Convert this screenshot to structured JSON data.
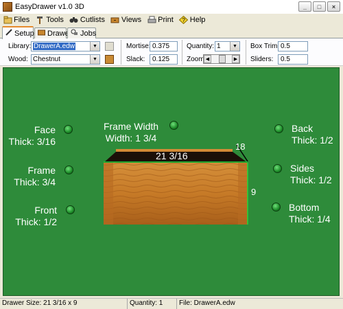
{
  "window": {
    "title": "EasyDrawer v1.0 3D",
    "buttons": [
      "_",
      "□",
      "×"
    ]
  },
  "menu": [
    {
      "label": "Files",
      "icon": "files-icon"
    },
    {
      "label": "Tools",
      "icon": "hammer-icon"
    },
    {
      "label": "Cutlists",
      "icon": "binoculars-icon"
    },
    {
      "label": "Views",
      "icon": "drawer-icon"
    },
    {
      "label": "Print",
      "icon": "printer-icon"
    },
    {
      "label": "Help",
      "icon": "help-diamond-icon"
    }
  ],
  "tabs": [
    {
      "label": "Setup",
      "active": true
    },
    {
      "label": "Drawer",
      "active": false
    },
    {
      "label": "Jobs",
      "active": false
    }
  ],
  "setup": {
    "library_label": "Library:",
    "library_value": "DrawerA.edw",
    "wood_label": "Wood:",
    "wood_value": "Chestnut",
    "mortise_label": "Mortise:",
    "mortise_value": "0.375",
    "slack_label": "Slack:",
    "slack_value": "0.125",
    "quantity_label": "Quantity:",
    "quantity_value": "1",
    "zoom_label": "Zoom:",
    "zoom_left": "◀",
    "zoom_right": "▶",
    "boxtrim_label": "Box Trim:",
    "boxtrim_value": "0.5",
    "sliders_label": "Sliders:",
    "sliders_value": "0.5",
    "dropdown_arrow": "▼"
  },
  "canvas": {
    "bg_color": "#2e8b3a",
    "face": {
      "line1": "Face",
      "line2": "Thick: 3/16"
    },
    "frame_width": {
      "line1": "Frame Width",
      "line2": "Width: 1 3/4"
    },
    "back": {
      "line1": "Back",
      "line2": "Thick: 1/2"
    },
    "frame": {
      "line1": "Frame",
      "line2": "Thick: 3/4"
    },
    "sides": {
      "line1": "Sides",
      "line2": "Thick: 1/2"
    },
    "front": {
      "line1": "Front",
      "line2": "Thick: 1/2"
    },
    "bottom": {
      "line1": "Bottom",
      "line2": "Thick: 1/4"
    },
    "dim_width": "21 3/16",
    "dim_depth": "18",
    "dim_height": "9"
  },
  "status": {
    "size": "Drawer Size: 21 3/16 x 9",
    "quantity": "Quantity: 1",
    "file": "File: DrawerA.edw"
  }
}
